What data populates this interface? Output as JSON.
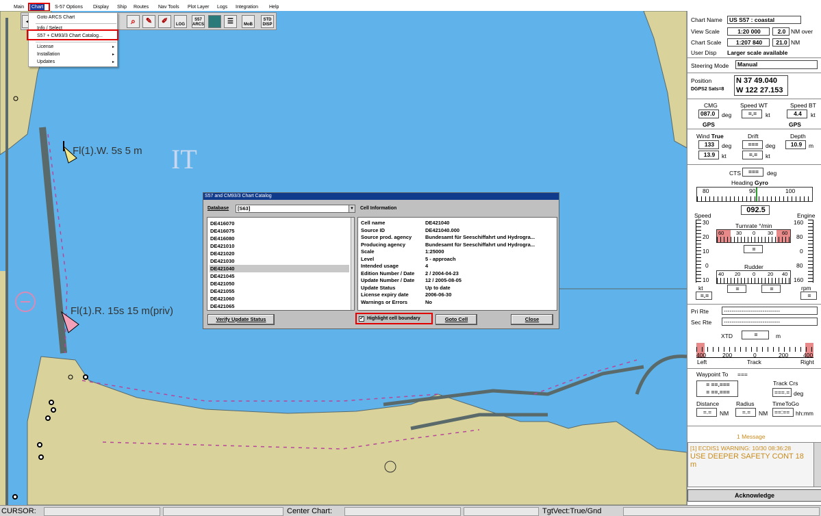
{
  "menu": [
    "Main",
    "Chart",
    "S-57 Options",
    "Display",
    "Ship",
    "Routes",
    "Nav Tools",
    "Plot Layer",
    "Logs",
    "Integration",
    "Help"
  ],
  "chart_dropdown": {
    "items": [
      "Goto ARCS Chart",
      "Info / Select",
      "S57 + CM93/3 Chart Catalog...",
      "License",
      "Installation",
      "Updates"
    ],
    "submenu_arrow": "▸"
  },
  "toolbar": {
    "log": "LOG",
    "s57": "S57 ARCS",
    "mob": "MoB",
    "std_disp": "STD DISP",
    "back_arrow": "◀"
  },
  "chart_labels": {
    "light1": "Fl(1).W. 5s 5 m",
    "light2": "Fl(1).R. 15s 15 m(priv)"
  },
  "dialog": {
    "title": "S57 and CM93/3 Chart Catalog",
    "database_label": "Database",
    "database_value": "[S63]",
    "cell_info_label": "Cell Information",
    "cells": [
      "DE416070",
      "DE416075",
      "DE416080",
      "DE421010",
      "DE421020",
      "DE421030",
      "DE421040",
      "DE421045",
      "DE421050",
      "DE421055",
      "DE421060",
      "DE421065"
    ],
    "selected_cell": "DE421040",
    "info": [
      {
        "k": "Cell name",
        "v": "DE421040"
      },
      {
        "k": "Source ID",
        "v": "DE421040.000"
      },
      {
        "k": "Source prod. agency",
        "v": "Bundesamt für Seeschiffahrt und Hydrogra..."
      },
      {
        "k": "Producing agency",
        "v": "Bundesamt für Seeschiffahrt und Hydrogra..."
      },
      {
        "k": "Scale",
        "v": "1:25000"
      },
      {
        "k": "Level",
        "v": "5 - approach"
      },
      {
        "k": "Intended usage",
        "v": "4"
      },
      {
        "k": "Edition Number / Date",
        "v": "2  /  2004-04-23"
      },
      {
        "k": "Update Number / Date",
        "v": "12  /  2005-08-05"
      },
      {
        "k": "Update Status",
        "v": "Up to date"
      },
      {
        "k": "License expiry date",
        "v": "2006-06-30"
      },
      {
        "k": "Warnings or Errors",
        "v": "No"
      }
    ],
    "btn_verify": "Verify Update Status",
    "chk_highlight": "Highlight cell boundary",
    "btn_goto": "Goto Cell",
    "btn_close": "Close"
  },
  "panel": {
    "chart_name_label": "Chart Name",
    "chart_name": "US S57 : coastal",
    "view_scale_label": "View Scale",
    "view_scale": "1:20 000",
    "view_nm": "2.0",
    "view_unit": "NM over",
    "chart_scale_label": "Chart Scale",
    "chart_scale": "1:207 840",
    "chart_nm": "21.0",
    "chart_unit": "NM",
    "user_disp_label": "User Disp",
    "user_disp": "Larger scale available",
    "steering_label": "Steering Mode",
    "steering": "Manual",
    "position_label": "Position",
    "dgps": "DGPS2 Sats=8",
    "lat": "N  37  49.040",
    "lon": "W  122  27.153",
    "cmg_label": "CMG",
    "cmg": "087.0",
    "deg": "deg",
    "gps": "GPS",
    "speedwt_label": "Speed WT",
    "speedwt": "=.=",
    "kt": "kt",
    "speedbt_label": "Speed BT",
    "speedbt": "4.4",
    "wind_label": "Wind",
    "wind_true": "True",
    "wind_deg": "133",
    "wind_kt": "13.9",
    "drift_label": "Drift",
    "drift_deg": "===",
    "drift_kt": "=.=",
    "depth_label": "Depth",
    "depth": "10.9",
    "m": "m",
    "cts_label": "CTS",
    "cts": "===",
    "heading_label": "Heading",
    "heading_src": "Gyro",
    "heading_ticks": [
      "80",
      "90",
      "100"
    ],
    "heading": "092.5",
    "speed_label": "Speed",
    "engine_label": "Engine",
    "speed_ticks": [
      "30",
      "20",
      "10",
      "0",
      "10"
    ],
    "engine_ticks": [
      "160",
      "80",
      "0",
      "80",
      "160"
    ],
    "turnrate_label": "Turnrate °/min",
    "turnrate_ticks": [
      "60",
      "30",
      "0",
      "30",
      "60"
    ],
    "turnrate_value": "=",
    "rudder_label": "Rudder",
    "rudder_ticks": [
      "40",
      "20",
      "0",
      "20",
      "40"
    ],
    "rudder_value": "=",
    "speed_value": "=.=",
    "rpm_label": "rpm",
    "rpm_value": "=",
    "pri_rte_label": "Pri Rte",
    "sec_rte_label": "Sec Rte",
    "rte_value": "-----------------------------",
    "xtd_label": "XTD",
    "xtd_value": "=",
    "xtd_ticks": [
      "400",
      "200",
      "0",
      "200",
      "400"
    ],
    "left": "Left",
    "track": "Track",
    "right": "Right",
    "waypoint_label": "Waypoint To",
    "waypoint_value": "===",
    "wp_line1": "=  ==.===",
    "wp_line2": "=  ==.===",
    "trackcrs_label": "Track Crs",
    "trackcrs": "===.=",
    "distance_label": "Distance",
    "distance": "=.=",
    "nm": "NM",
    "radius_label": "Radius",
    "radius": "=.=",
    "ttg_label": "TimeToGo",
    "ttg": "==:==",
    "hhmm": "hh:mm",
    "messages_label": "1 Message",
    "message_line1": "[1] ECDIS1 WARNING: 10/30 08:36:28",
    "message_line2": "USE DEEPER SAFETY CONT 18 m",
    "acknowledge": "Acknowledge"
  },
  "status": {
    "cursor": "CURSOR:",
    "center": "Center Chart:",
    "tgtvect": "TgtVect:True/Gnd"
  },
  "colors": {
    "sea": "#5fb3ea",
    "land": "#d9d29a",
    "coast": "#5a6a6a",
    "title": "#103a8c",
    "warning": "#c88a1a",
    "alarm": "#e00000"
  }
}
